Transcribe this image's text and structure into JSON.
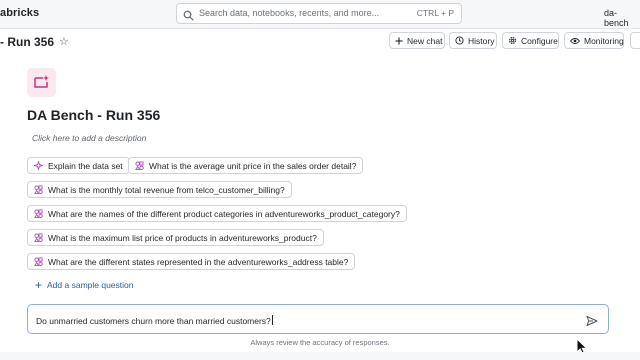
{
  "topbar": {
    "brand": "abricks",
    "search_placeholder": "Search data, notebooks, recents, and more...",
    "search_shortcut": "CTRL + P",
    "workspace": "da-bench"
  },
  "header": {
    "page_title": "- Run 356",
    "buttons": {
      "new_chat": "New chat",
      "history": "History",
      "configure": "Configure",
      "monitoring": "Monitoring"
    }
  },
  "space": {
    "title": "DA Bench - Run 356",
    "description_placeholder": "Click here to add a description",
    "chips": [
      {
        "label": "Explain the data set",
        "icon": "sparkle-icon"
      },
      {
        "label": "What is the average unit price in the sales order detail?",
        "icon": "shapes-icon"
      },
      {
        "label": "What is the monthly total revenue from telco_customer_billing?",
        "icon": "shapes-icon"
      },
      {
        "label": "What are the names of the different product categories in adventureworks_product_category?",
        "icon": "shapes-icon"
      },
      {
        "label": "What is the maximum list price of products in adventureworks_product?",
        "icon": "shapes-icon"
      },
      {
        "label": "What are the different states represented in the adventureworks_address table?",
        "icon": "shapes-icon"
      }
    ],
    "add_sample_label": "Add a sample question"
  },
  "chat_input": {
    "value": "Do unmarried customers churn more than married customers?"
  },
  "footer": {
    "disclaimer": "Always review the accuracy of responses."
  },
  "colors": {
    "accent": "#2a5ea8",
    "logo_bg": "#fbe9f1",
    "logo_fg": "#c2387a",
    "chip_icon": "#b14eb3"
  }
}
